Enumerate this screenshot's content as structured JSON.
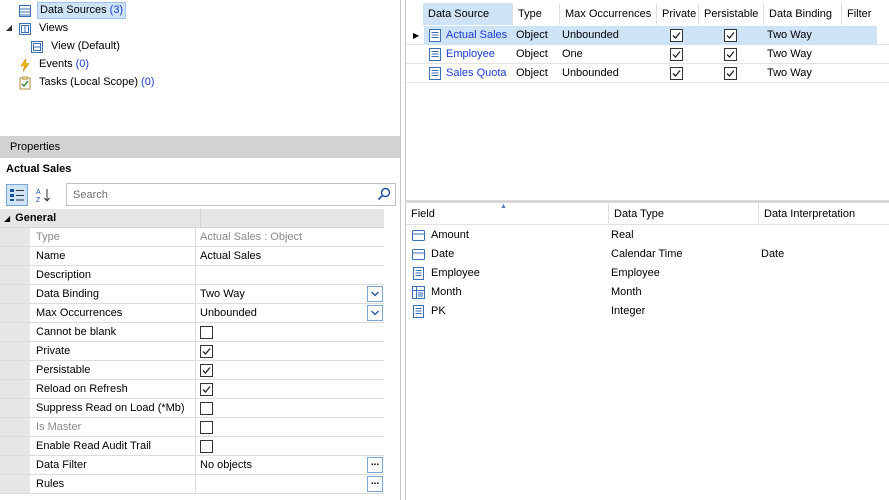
{
  "tree": {
    "data_sources": {
      "label": "Data Sources",
      "count": "(3)"
    },
    "views": {
      "label": "Views"
    },
    "view_default": {
      "label": "View (Default)"
    },
    "events": {
      "label": "Events",
      "count": "(0)"
    },
    "tasks": {
      "label": "Tasks (Local Scope)",
      "count": "(0)"
    }
  },
  "properties": {
    "header": "Properties",
    "object_name": "Actual Sales",
    "search_placeholder": "Search",
    "category": "General",
    "rows": [
      {
        "name": "Type",
        "value": "Actual Sales : Object",
        "kind": "text",
        "readonly": true
      },
      {
        "name": "Name",
        "value": "Actual Sales",
        "kind": "text"
      },
      {
        "name": "Description",
        "value": "",
        "kind": "text"
      },
      {
        "name": "Data Binding",
        "value": "Two Way",
        "kind": "dropdown"
      },
      {
        "name": "Max Occurrences",
        "value": "Unbounded",
        "kind": "dropdown"
      },
      {
        "name": "Cannot be blank",
        "value": false,
        "kind": "check"
      },
      {
        "name": "Private",
        "value": true,
        "kind": "check"
      },
      {
        "name": "Persistable",
        "value": true,
        "kind": "check"
      },
      {
        "name": "Reload on Refresh",
        "value": true,
        "kind": "check"
      },
      {
        "name": "Suppress Read on Load (*Mb)",
        "value": false,
        "kind": "check"
      },
      {
        "name": "Is Master",
        "value": false,
        "kind": "check",
        "readonly": true
      },
      {
        "name": "Enable Read Audit Trail",
        "value": false,
        "kind": "check"
      },
      {
        "name": "Data Filter",
        "value": "No objects",
        "kind": "ellipsis"
      },
      {
        "name": "Rules",
        "value": "",
        "kind": "ellipsis"
      }
    ]
  },
  "data_sources_table": {
    "columns": [
      "Data Source",
      "Type",
      "Max Occurrences",
      "Private",
      "Persistable",
      "Data Binding",
      "Filter"
    ],
    "rows": [
      {
        "name": "Actual Sales",
        "type": "Object",
        "max": "Unbounded",
        "private": true,
        "persistable": true,
        "binding": "Two Way",
        "selected": true
      },
      {
        "name": "Employee",
        "type": "Object",
        "max": "One",
        "private": true,
        "persistable": true,
        "binding": "Two Way",
        "selected": false
      },
      {
        "name": "Sales Quota",
        "type": "Object",
        "max": "Unbounded",
        "private": true,
        "persistable": true,
        "binding": "Two Way",
        "selected": false
      }
    ]
  },
  "fields_table": {
    "columns": [
      "Field",
      "Data Type",
      "Data Interpretation"
    ],
    "rows": [
      {
        "field": "Amount",
        "type": "Real",
        "interp": "",
        "icon": "table-icon"
      },
      {
        "field": "Date",
        "type": "Calendar Time",
        "interp": "Date",
        "icon": "table-icon"
      },
      {
        "field": "Employee",
        "type": "Employee",
        "interp": "",
        "icon": "list-icon"
      },
      {
        "field": "Month",
        "type": "Month",
        "interp": "",
        "icon": "grid-icon"
      },
      {
        "field": "PK",
        "type": "Integer",
        "interp": "",
        "icon": "list-icon"
      }
    ]
  },
  "colors": {
    "selection": "#cfe3f7",
    "link": "#1a3ccf",
    "header_gray": "#d2d2d2"
  }
}
